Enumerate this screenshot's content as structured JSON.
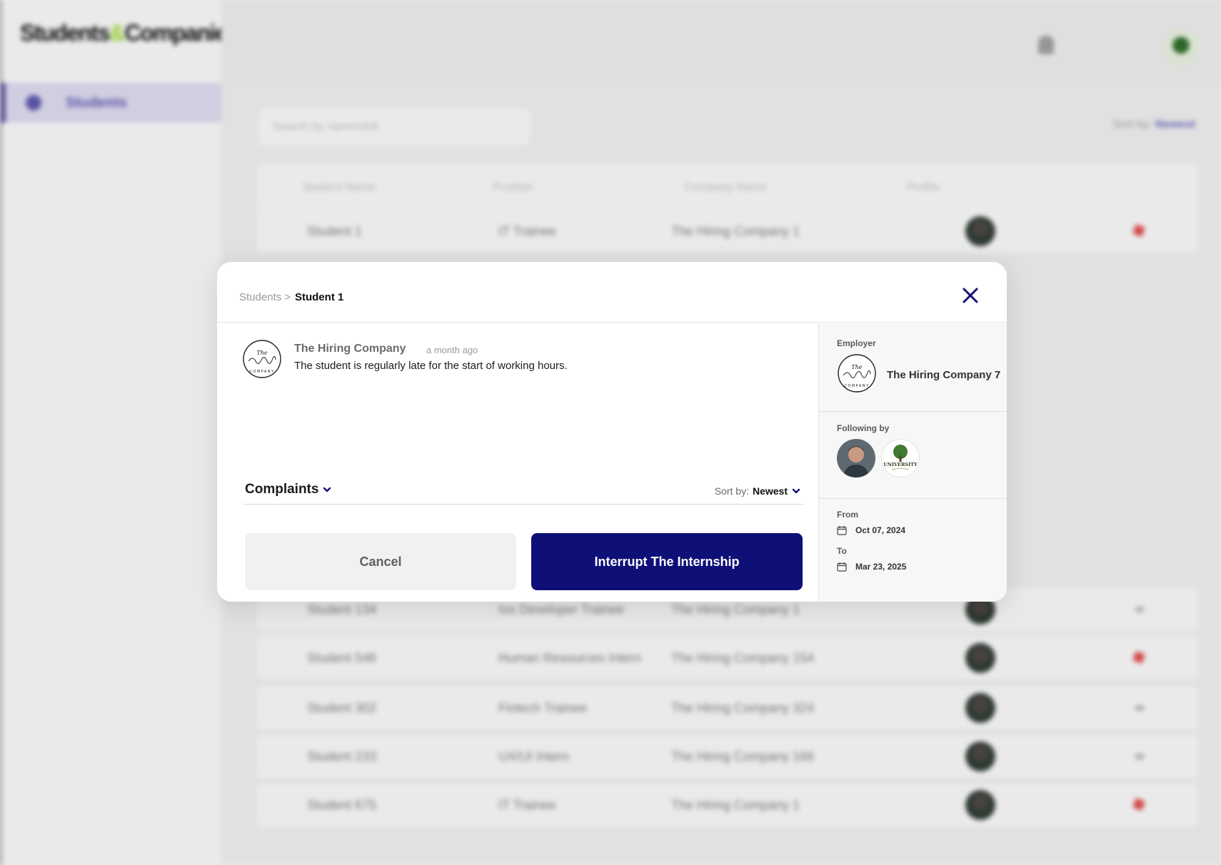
{
  "app": {
    "logo_part1": "Students",
    "logo_accent": "&",
    "logo_part2": "Companies",
    "nav_students": "Students"
  },
  "list": {
    "search_placeholder": "Search by name/skill",
    "sort_label": "Sort by:",
    "sort_value": "Newest",
    "columns": [
      "Student Name",
      "Position",
      "Company Name",
      "Profile"
    ],
    "rows": [
      {
        "name": "Student 1",
        "position": "IT Trainee",
        "company": "The Hiring Company 1",
        "flag": true
      },
      {
        "name": "Student 134",
        "position": "Ios Developer Trainee",
        "company": "The Hiring Company 1",
        "flag": false
      },
      {
        "name": "Student 546",
        "position": "Human Resources Intern",
        "company": "The Hiring Company 154",
        "flag": true
      },
      {
        "name": "Student 302",
        "position": "Fintech Trainee",
        "company": "The Hiring Company 324",
        "flag": false
      },
      {
        "name": "Student 233",
        "position": "UX/UI Intern",
        "company": "The Hiring Company 166",
        "flag": false
      },
      {
        "name": "Student 675",
        "position": "IT Trainee",
        "company": "The Hiring Company 1",
        "flag": true
      }
    ]
  },
  "modal": {
    "breadcrumb_parent": "Students",
    "breadcrumb_sep": ">",
    "breadcrumb_current": "Student 1",
    "comment": {
      "author": "The Hiring Company",
      "time": "a month ago",
      "text": "The student is regularly late for the start of working hours."
    },
    "complaints_label": "Complaints",
    "sort_label": "Sort by:",
    "sort_value": "Newest",
    "cancel_label": "Cancel",
    "interrupt_label": "Interrupt The Internship",
    "employer_label": "Employer",
    "employer_name": "The Hiring Company 7",
    "following_label": "Following by",
    "from_label": "From",
    "from_date": "Oct 07, 2024",
    "to_label": "To",
    "to_date": "Mar 23, 2025",
    "university_text": "UNIVERSITY"
  },
  "colors": {
    "primary": "#0f0f78",
    "accent": "#9bd33a",
    "nav_active": "#5b55a8"
  }
}
